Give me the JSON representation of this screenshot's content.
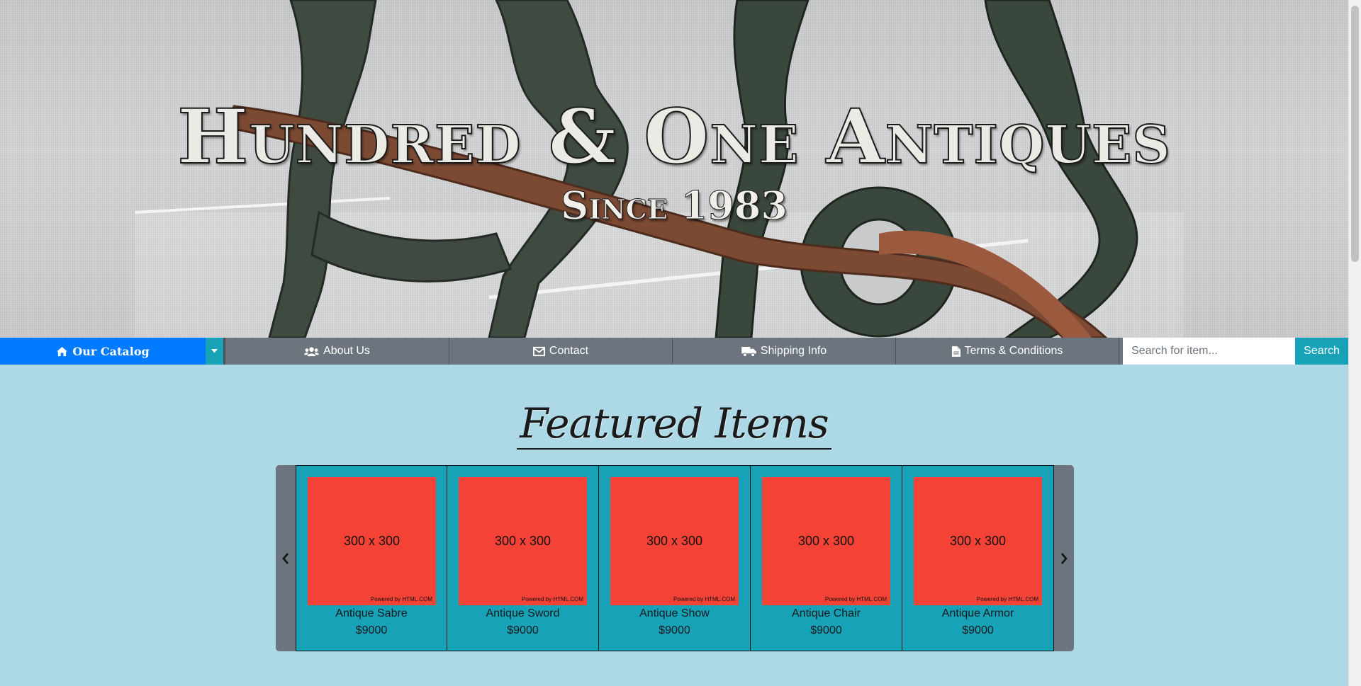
{
  "hero": {
    "title": "Hundred & One Antiques",
    "subtitle": "Since 1983"
  },
  "nav": {
    "catalog": {
      "label": "Our Catalog",
      "icon": "home-icon"
    },
    "dropdown_icon": "caret-down-icon",
    "items": [
      {
        "label": "About Us",
        "icon": "users-icon"
      },
      {
        "label": "Contact",
        "icon": "envelope-icon"
      },
      {
        "label": "Shipping Info",
        "icon": "truck-icon"
      },
      {
        "label": "Terms & Conditions",
        "icon": "document-icon"
      }
    ],
    "search": {
      "placeholder": "Search for item...",
      "button_label": "Search"
    }
  },
  "featured": {
    "heading": "Featured Items",
    "prev_icon": "chevron-left-icon",
    "next_icon": "chevron-right-icon",
    "items": [
      {
        "image_text": "300 x 300",
        "image_credit": "Powered by HTML.COM",
        "name": "Antique Sabre",
        "price": "$9000"
      },
      {
        "image_text": "300 x 300",
        "image_credit": "Powered by HTML.COM",
        "name": "Antique Sword",
        "price": "$9000"
      },
      {
        "image_text": "300 x 300",
        "image_credit": "Powered by HTML.COM",
        "name": "Antique Show",
        "price": "$9000"
      },
      {
        "image_text": "300 x 300",
        "image_credit": "Powered by HTML.COM",
        "name": "Antique Chair",
        "price": "$9000"
      },
      {
        "image_text": "300 x 300",
        "image_credit": "Powered by HTML.COM",
        "name": "Antique Armor",
        "price": "$9000"
      }
    ]
  },
  "colors": {
    "page_bg": "#add8e6",
    "primary": "#007bff",
    "info": "#17a2b8",
    "nav_gray": "#6c757d",
    "placeholder_red": "#f44336"
  }
}
